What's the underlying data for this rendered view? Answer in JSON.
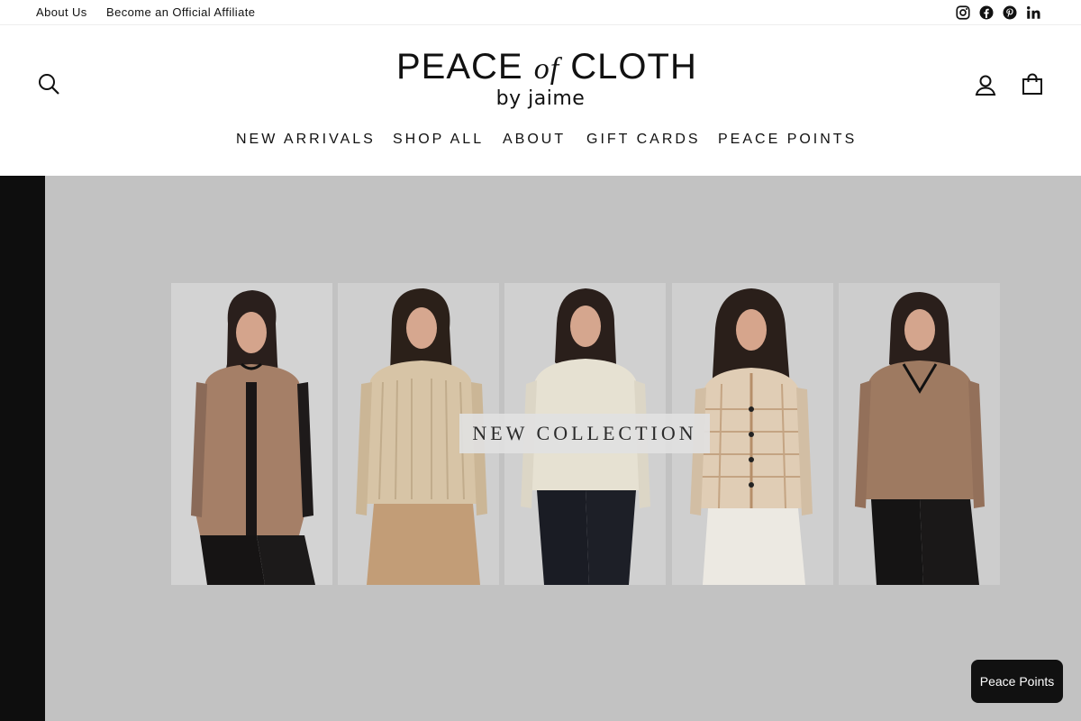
{
  "topbar": {
    "links": [
      "About Us",
      "Become an Official Affiliate"
    ],
    "social_icons": [
      "instagram-icon",
      "facebook-icon",
      "pinterest-icon",
      "linkedin-icon"
    ]
  },
  "header": {
    "logo": {
      "word1": "PEACE ",
      "word2": "of",
      "word3": " CLOTH",
      "sub": "by jaime"
    },
    "icons": [
      "search-icon",
      "account-icon",
      "cart-icon"
    ]
  },
  "nav": {
    "items": [
      "NEW ARRIVALS",
      "SHOP ALL",
      "ABOUT",
      "GIFT CARDS",
      "PEACE POINTS"
    ]
  },
  "hero": {
    "label": "NEW COLLECTION",
    "background": "#c2c2c2",
    "left_bar": "#0e0e0e"
  },
  "floating": {
    "button_label": "Peace Points"
  }
}
